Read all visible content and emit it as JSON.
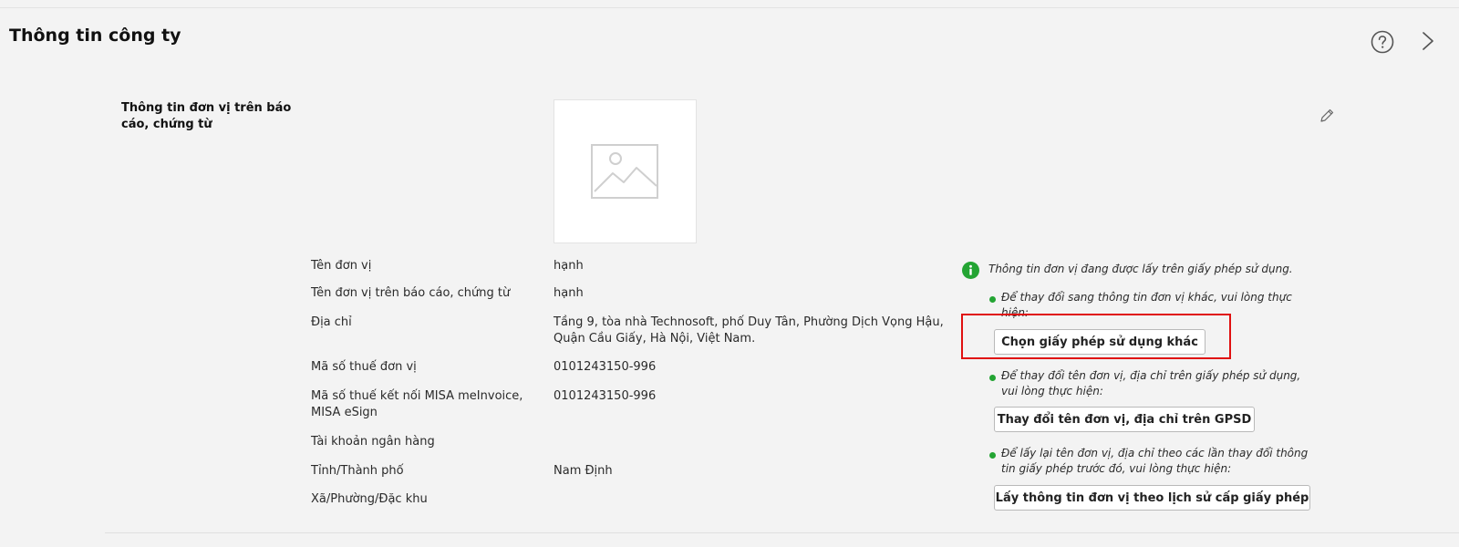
{
  "header": {
    "title": "Thông tin công ty"
  },
  "section": {
    "title": "Thông tin đơn vị trên báo cáo, chứng từ"
  },
  "icons": {
    "help": "help-circle-icon",
    "close": "chevron-right-icon",
    "edit": "pencil-icon",
    "logo_placeholder": "image-placeholder-icon",
    "info": "info-icon"
  },
  "fields": [
    {
      "label": "Tên đơn vị",
      "value": "hạnh"
    },
    {
      "label": "Tên đơn vị trên báo cáo, chứng từ",
      "value": "hạnh"
    },
    {
      "label": "Địa chỉ",
      "value": "Tầng 9, tòa nhà Technosoft, phố Duy Tân, Phường Dịch Vọng Hậu, Quận Cầu Giấy, Hà Nội, Việt Nam."
    },
    {
      "label": "Mã số thuế đơn vị",
      "value": "0101243150-996"
    },
    {
      "label": "Mã số thuế kết nối MISA meInvoice, MISA eSign",
      "value": "0101243150-996"
    },
    {
      "label": "Tài khoản ngân hàng",
      "value": ""
    },
    {
      "label": "Tỉnh/Thành phố",
      "value": "Nam Định"
    },
    {
      "label": "Xã/Phường/Đặc khu",
      "value": ""
    }
  ],
  "license_note": {
    "intro": "Thông tin đơn vị đang được lấy trên giấy phép sử dụng.",
    "items": [
      {
        "text": "Để thay đổi sang thông tin đơn vị khác, vui lòng thực hiện:",
        "button": "Chọn giấy phép sử dụng khác"
      },
      {
        "text": "Để thay đổi tên đơn vị, địa chỉ trên giấy phép sử dụng, vui lòng thực hiện:",
        "button": "Thay đổi tên đơn vị, địa chỉ trên GPSD"
      },
      {
        "text": "Để lấy lại tên đơn vị, địa chỉ theo các lần thay đổi thông tin giấy phép trước đó, vui lòng thực hiện:",
        "button": "Lấy thông tin đơn vị theo lịch sử cấp giấy phép"
      }
    ]
  },
  "colors": {
    "accent_green": "#23a433",
    "highlight_red": "#e01010",
    "background": "#f3f3f3"
  }
}
